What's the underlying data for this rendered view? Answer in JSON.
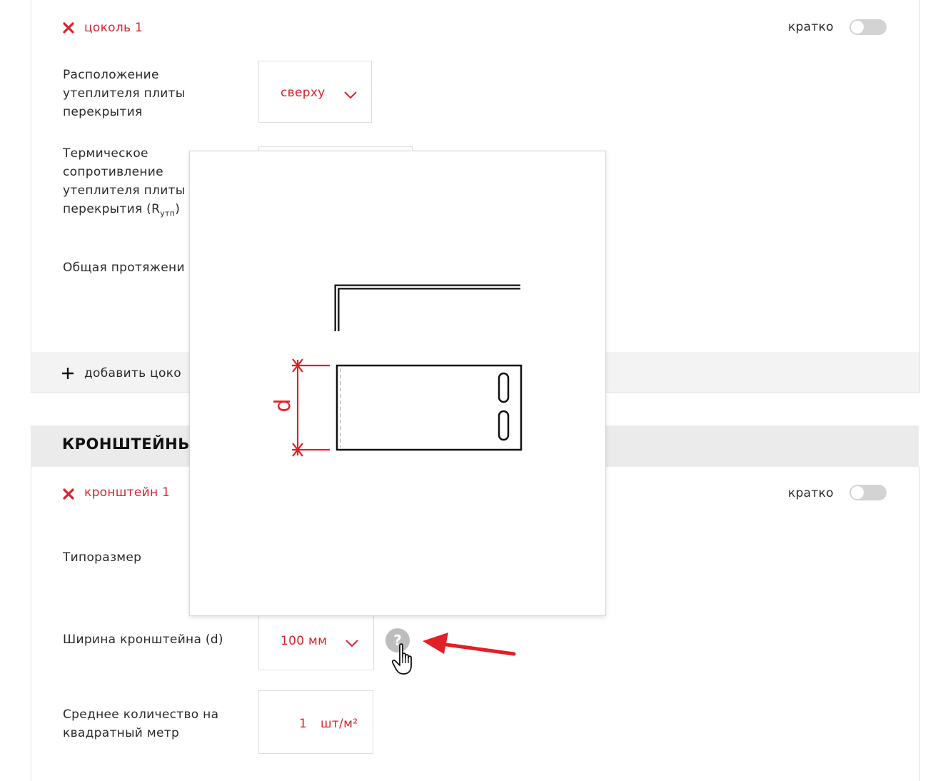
{
  "plinth_block": {
    "item_title": "цоколь 1",
    "short_label": "кратко",
    "location_label_lines": [
      "Расположение",
      "утеплителя плиты",
      "перекрытия"
    ],
    "location_value": "сверху",
    "thermal_label_lines": [
      "Термическое",
      "сопротивление",
      "утеплителя плиты",
      "перекрытия (R"
    ],
    "thermal_subscript": "утп",
    "thermal_suffix": ")",
    "length_label": "Общая протяжени",
    "add_label": "добавить цоко"
  },
  "brackets_section": {
    "title": "КРОНШТЕЙНЫ",
    "item_title": "кронштейн 1",
    "short_label": "кратко",
    "size_label": "Типоразмер",
    "width_label": "Ширина кронштейна (d)",
    "width_value": "100 мм",
    "qty_label_lines": [
      "Среднее количество на",
      "квадратный метр"
    ],
    "qty_value": "1",
    "qty_unit": "шт/м²"
  },
  "popup": {
    "dimension_label": "d"
  },
  "help_icon_glyph": "?",
  "colors": {
    "accent": "#d8232a",
    "toggle_off": "#d3d3d3",
    "section_bg": "#ebebeb"
  }
}
